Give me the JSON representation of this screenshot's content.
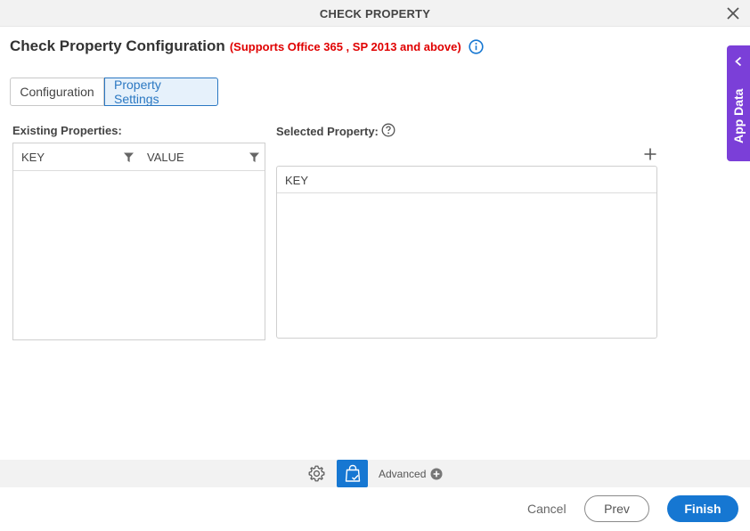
{
  "window": {
    "title": "CHECK PROPERTY"
  },
  "heading": {
    "title": "Check Property Configuration",
    "support_note": "(Supports Office 365 , SP 2013 and above)"
  },
  "tabs": [
    {
      "label": "Configuration",
      "active": false
    },
    {
      "label": "Property Settings",
      "active": true
    }
  ],
  "existing_properties": {
    "label": "Existing Properties:",
    "columns": [
      "KEY",
      "VALUE"
    ],
    "rows": []
  },
  "selected_property": {
    "label": "Selected Property:",
    "columns": [
      "KEY"
    ],
    "rows": []
  },
  "side_panel": {
    "label": "App Data"
  },
  "toolbar": {
    "advanced_label": "Advanced"
  },
  "footer": {
    "cancel_label": "Cancel",
    "prev_label": "Prev",
    "finish_label": "Finish"
  },
  "colors": {
    "accent": "#1677d2",
    "warning": "#e00000",
    "app_data": "#7b3fd8"
  },
  "icons": [
    "close-icon",
    "info-icon",
    "filter-icon",
    "help-icon",
    "plus-icon",
    "chevron-left-icon",
    "gear-icon",
    "shopping-bag-check-icon",
    "add-circle-icon"
  ]
}
